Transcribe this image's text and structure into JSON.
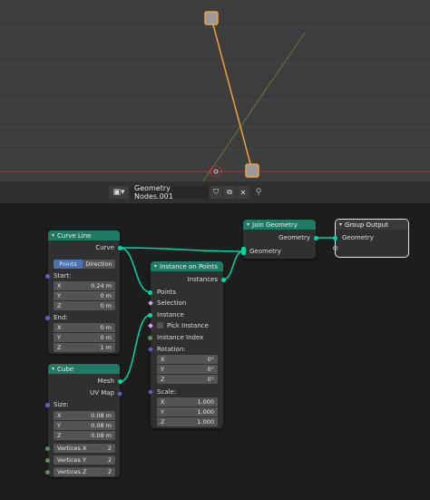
{
  "header": {
    "editor_icon": "node-editor-icon",
    "tree_name": "Geometry Nodes.001",
    "shield_icon": "shield-icon",
    "copy_icon": "copy-icon",
    "close_icon": "close-icon",
    "pin_icon": "pin-icon"
  },
  "nodes": {
    "curve_line": {
      "title": "Curve Line",
      "out_curve": "Curve",
      "mode_points": "Points",
      "mode_direction": "Direction",
      "start_label": "Start:",
      "start_x_label": "X",
      "start_x": "0.24 m",
      "start_y_label": "Y",
      "start_y": "0 m",
      "start_z_label": "Z",
      "start_z": "0 m",
      "end_label": "End:",
      "end_x_label": "X",
      "end_x": "0 m",
      "end_y_label": "Y",
      "end_y": "0 m",
      "end_z_label": "Z",
      "end_z": "1 m"
    },
    "cube": {
      "title": "Cube",
      "out_mesh": "Mesh",
      "out_uvmap": "UV Map",
      "size_label": "Size:",
      "size_x_label": "X",
      "size_x": "0.08 m",
      "size_y_label": "Y",
      "size_y": "0.08 m",
      "size_z_label": "Z",
      "size_z": "0.08 m",
      "vx_label": "Vertices X",
      "vx": "2",
      "vy_label": "Vertices Y",
      "vy": "2",
      "vz_label": "Vertices Z",
      "vz": "2"
    },
    "instance_on_points": {
      "title": "Instance on Points",
      "out_instances": "Instances",
      "in_points": "Points",
      "in_selection": "Selection",
      "in_instance": "Instance",
      "pick_instance": "Pick Instance",
      "instance_index": "Instance Index",
      "rotation_label": "Rotation:",
      "rot_x_label": "X",
      "rot_x": "0°",
      "rot_y_label": "Y",
      "rot_y": "0°",
      "rot_z_label": "Z",
      "rot_z": "0°",
      "scale_label": "Scale:",
      "scale_x_label": "X",
      "scale_x": "1.000",
      "scale_y_label": "Y",
      "scale_y": "1.000",
      "scale_z_label": "Z",
      "scale_z": "1.000"
    },
    "join_geometry": {
      "title": "Join Geometry",
      "out_geometry": "Geometry",
      "in_geometry": "Geometry"
    },
    "group_output": {
      "title": "Group Output",
      "in_geometry": "Geometry"
    }
  },
  "colors": {
    "geometry_socket": "#00d6a3",
    "node_header": "#1e7a63",
    "selected_orange": "#f0a040",
    "x_axis": "#9c3a3a",
    "y_axis": "#6a8a3a"
  }
}
